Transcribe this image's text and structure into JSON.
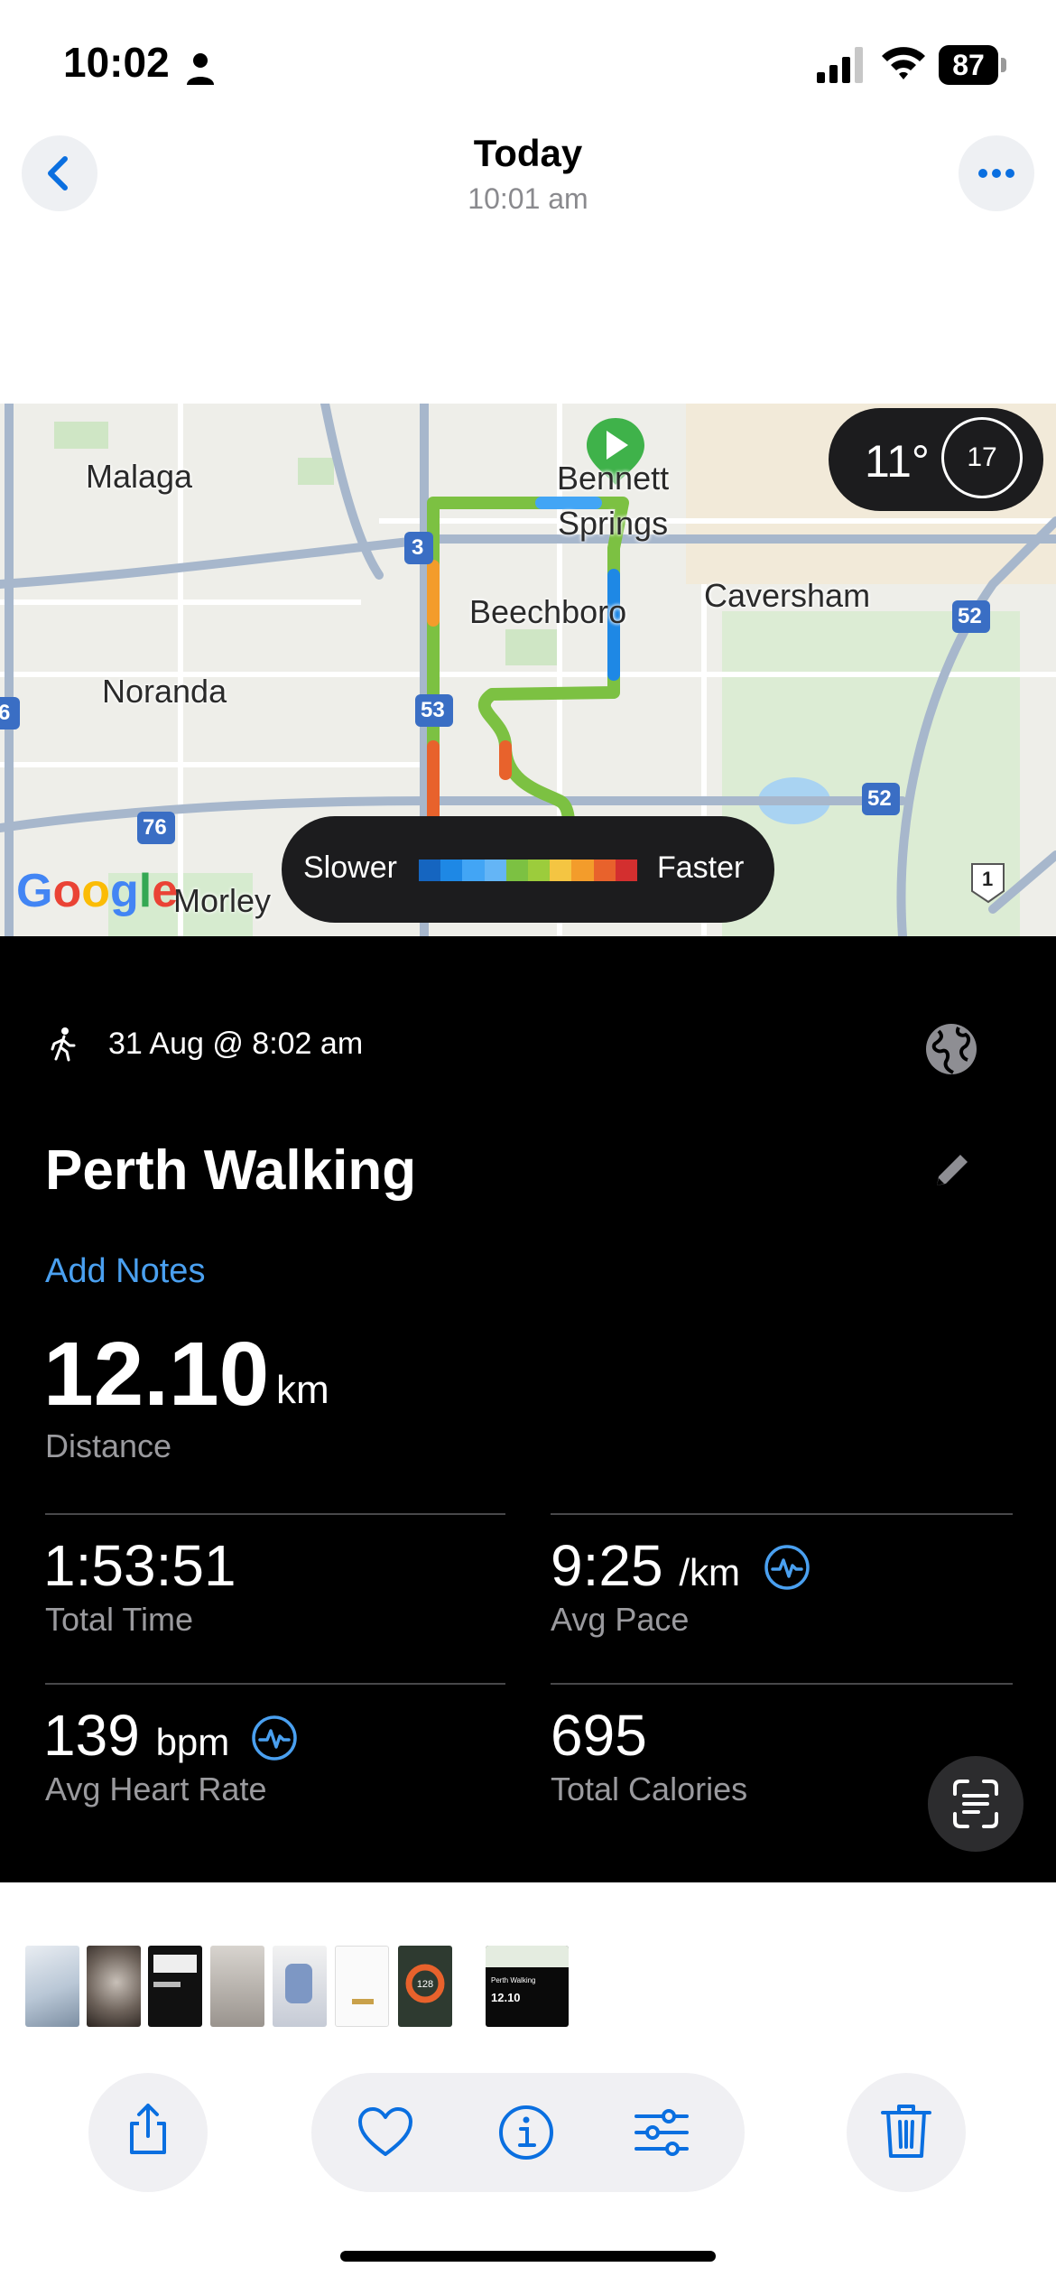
{
  "status_bar": {
    "time": "10:02",
    "battery": "87"
  },
  "header": {
    "title": "Today",
    "subtitle": "10:01 am"
  },
  "map": {
    "labels": {
      "malaga": "Malaga",
      "bennett": "Bennett",
      "springs": "Springs",
      "caversham": "Caversham",
      "beechboro": "Beechboro",
      "noranda": "Noranda",
      "morley": "Morley",
      "road_3": "3",
      "road_53": "53",
      "road_76": "76",
      "road_52a": "52",
      "road_52b": "52",
      "road_1": "1",
      "road_6": "6"
    },
    "weather": {
      "temp": "11°",
      "wind": "17"
    },
    "legend": {
      "slower": "Slower",
      "faster": "Faster"
    },
    "attribution": "Google",
    "speed_colors": [
      "#1565c0",
      "#1e88e5",
      "#42a5f5",
      "#64b5f6",
      "#7cc142",
      "#9ccc3c",
      "#f4c542",
      "#f39c2b",
      "#e8622c",
      "#d32f2f"
    ]
  },
  "activity": {
    "date": "31 Aug @ 8:02 am",
    "title": "Perth Walking",
    "add_notes": "Add Notes",
    "distance": {
      "value": "12.10",
      "unit": "km",
      "label": "Distance"
    },
    "total_time": {
      "value": "1:53:51",
      "label": "Total Time"
    },
    "avg_pace": {
      "value": "9:25",
      "unit": "/km",
      "label": "Avg Pace"
    },
    "avg_heart_rate": {
      "value": "139",
      "unit": "bpm",
      "label": "Avg Heart Rate"
    },
    "total_calories": {
      "value": "695",
      "label": "Total Calories"
    }
  },
  "thumbnails": {
    "t7": "128",
    "t8_title": "Perth Walking",
    "t8_value": "12.10"
  },
  "colors": {
    "accent": "#0a6fe0",
    "link": "#4aa0f0",
    "route": "#7cc142"
  }
}
